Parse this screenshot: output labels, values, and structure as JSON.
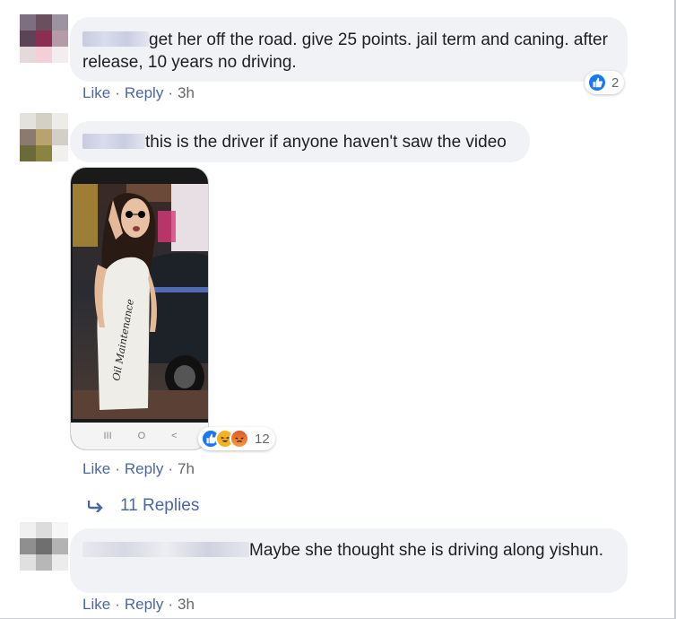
{
  "comments": [
    {
      "text": "get her off the road. give 25 points. jail term and caning. after release, 10 years no driving.",
      "actions": {
        "like": "Like",
        "reply": "Reply",
        "time": "3h"
      },
      "reactions": {
        "count": "2"
      }
    },
    {
      "text": "this is the driver if anyone haven't saw the video",
      "actions": {
        "like": "Like",
        "reply": "Reply",
        "time": "7h"
      },
      "reactions": {
        "count": "12"
      },
      "attachment": {
        "overlay_text": "Oil Maintenance",
        "nav_glyphs": [
          "III",
          "O",
          "<"
        ]
      }
    },
    {
      "text": "Maybe she thought she is driving along yishun.",
      "actions": {
        "like": "Like",
        "reply": "Reply",
        "time": "3h"
      }
    }
  ],
  "replies_link": "11 Replies",
  "separator": "·",
  "colors": {
    "link": "#4b67a3",
    "bubble": "#f0f2f5",
    "like_blue": "#1877f2"
  }
}
